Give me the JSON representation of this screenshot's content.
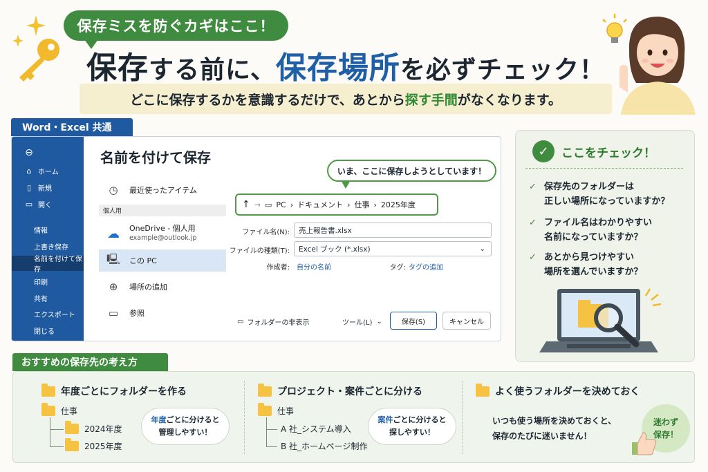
{
  "header": {
    "pill": "保存ミスを防ぐカギはここ！",
    "headline_part1": "保存",
    "headline_part2": "する前に、",
    "headline_part3": "保存場所",
    "headline_part4": "を必ずチェック！",
    "sub_part1": "どこに保存するかを意識するだけで、あとから",
    "sub_part2": "探す手間",
    "sub_part3": "がなくなります。"
  },
  "window": {
    "tag": "Word・Excel 共通",
    "title": "名前を付けて保存",
    "sidebar": [
      {
        "label": "ホーム",
        "icon": "home-icon"
      },
      {
        "label": "新規",
        "icon": "new-file-icon"
      },
      {
        "label": "開く",
        "icon": "folder-open-icon"
      },
      {
        "label": "情報"
      },
      {
        "label": "上書き保存"
      },
      {
        "label": "名前を付けて保存",
        "active": true
      },
      {
        "label": "印刷"
      },
      {
        "label": "共有"
      },
      {
        "label": "エクスポート"
      },
      {
        "label": "閉じる"
      }
    ],
    "locations": {
      "recent": "最近使ったアイテム",
      "personal_header": "個人用",
      "onedrive": "OneDrive - 個人用",
      "onedrive_email": "example@outlook.jp",
      "this_pc": "この PC",
      "add_place": "場所の追加",
      "browse": "参照"
    },
    "bubble": "いま、ここに保存しようとしています！",
    "breadcrumb": [
      "PC",
      "ドキュメント",
      "仕事",
      "2025年度"
    ],
    "filename_label": "ファイル名(N):",
    "filename_value": "売上報告書.xlsx",
    "filetype_label": "ファイルの種類(T):",
    "filetype_value": "Excel ブック (*.xlsx)",
    "author_label": "作成者:",
    "author_value": "自分の名前",
    "tags_label": "タグ:",
    "tags_value": "タグの追加",
    "hide_folders": "フォルダーの非表示",
    "tools": "ツール(L)",
    "save": "保存(S)",
    "cancel": "キャンセル"
  },
  "checklist": {
    "title": "ここをチェック！",
    "items": [
      {
        "line1": "保存先のフォルダーは",
        "line2": "正しい場所になっていますか？"
      },
      {
        "line1": "ファイル名はわかりやすい",
        "line2": "名前になっていますか？"
      },
      {
        "line1": "あとから見つけやすい",
        "line2": "場所を選んでいますか？"
      }
    ]
  },
  "recommend": {
    "tag": "おすすめの保存先の考え方",
    "col1": {
      "title": "年度ごとにフォルダーを作る",
      "root": "仕事",
      "children": [
        "2024年度",
        "2025年度"
      ],
      "cloud_blue": "年度",
      "cloud_rest": "ごとに分けると",
      "cloud_line2": "管理しやすい！"
    },
    "col2": {
      "title": "プロジェクト・案件ごとに分ける",
      "root": "仕事",
      "children": [
        "A 社_システム導入",
        "B 社_ホームページ制作"
      ],
      "cloud_blue": "案件",
      "cloud_rest": "ごとに分けると",
      "cloud_line2": "探しやすい！"
    },
    "col3": {
      "title": "よく使うフォルダーを決めておく",
      "line1": "いつも使う場所を決めておくと、",
      "line2": "保存のたびに迷いません！",
      "badge_line1": "迷わず",
      "badge_line2": "保存！"
    }
  },
  "colors": {
    "green": "#3f8b3f",
    "blue": "#1f5aa0",
    "yellow": "#f6efcf"
  }
}
